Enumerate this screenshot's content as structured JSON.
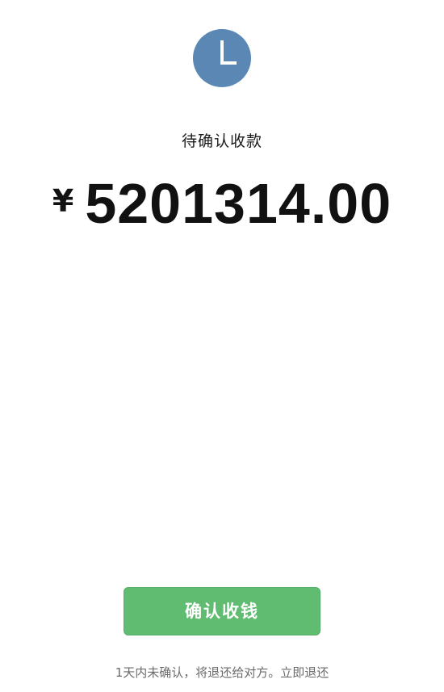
{
  "status": {
    "icon": "clock-icon",
    "icon_color": "#5b87b5",
    "label": "待确认收款"
  },
  "amount": {
    "currency_symbol": "¥",
    "value": "5201314.00"
  },
  "actions": {
    "confirm_label": "确认收钱",
    "confirm_color": "#5fbc70"
  },
  "footer": {
    "notice": "1天内未确认，将退还给对方。",
    "refund_link": "立即退还"
  }
}
